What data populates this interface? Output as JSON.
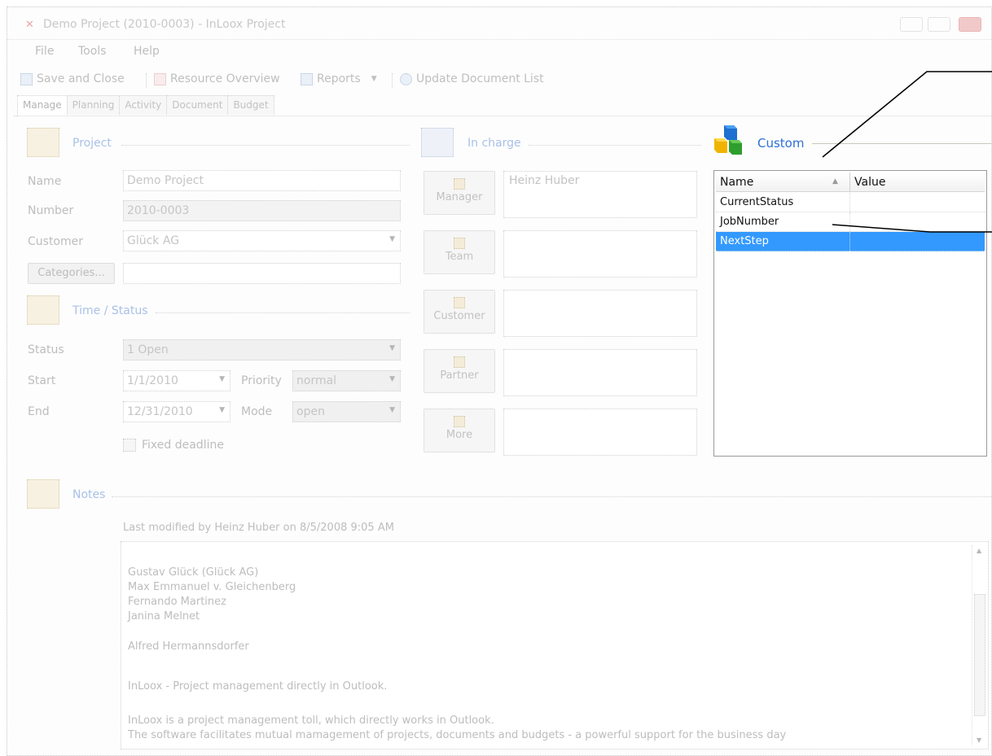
{
  "window": {
    "title": "Demo Project (2010-0003) - InLoox Project",
    "app_icon": "flame-icon"
  },
  "menu": [
    "File",
    "Tools",
    "Help"
  ],
  "toolbar": {
    "save": "Save and Close",
    "resource": "Resource Overview",
    "reports": "Reports",
    "update": "Update Document List"
  },
  "tabs": [
    "Manage",
    "Planning",
    "Activity",
    "Document",
    "Budget"
  ],
  "project": {
    "section_title": "Project",
    "name_label": "Name",
    "name_value": "Demo Project",
    "number_label": "Number",
    "number_value": "2010-0003",
    "customer_label": "Customer",
    "customer_value": "Glück AG",
    "categories_button": "Categories..."
  },
  "time_status": {
    "section_title": "Time / Status",
    "status_label": "Status",
    "status_value": "1 Open",
    "start_label": "Start",
    "start_value": "1/1/2010",
    "end_label": "End",
    "end_value": "12/31/2010",
    "priority_label": "Priority",
    "priority_value": "normal",
    "mode_label": "Mode",
    "mode_value": "open",
    "fixed_deadline_label": "Fixed deadline"
  },
  "in_charge": {
    "section_title": "In charge",
    "manager_button": "Manager",
    "manager_value": "Heinz Huber",
    "team_button": "Team",
    "customer_button": "Customer",
    "partner_button": "Partner",
    "more_button": "More"
  },
  "custom": {
    "section_title": "Custom",
    "col_name": "Name",
    "col_value": "Value",
    "rows": [
      {
        "name": "CurrentStatus",
        "value": ""
      },
      {
        "name": "JobNumber",
        "value": ""
      },
      {
        "name": "NextStep",
        "value": ""
      }
    ],
    "selected_row": 2
  },
  "notes": {
    "section_title": "Notes",
    "meta": "Last modified by Heinz Huber on 8/5/2008 9:05 AM",
    "lines": [
      "Gustav Glück  (Glück AG)",
      "Max Emmanuel v. Gleichenberg",
      "Fernando Martinez",
      "Janina Melnet",
      "Alfred Hermannsdorfer",
      "InLoox - Project management  directly in Outlook.",
      "InLoox is a project management toll, which directly works in Outlook.",
      "The software facilitates mutual mamagement of projects, documents and budgets - a powerful support for the business day"
    ]
  }
}
